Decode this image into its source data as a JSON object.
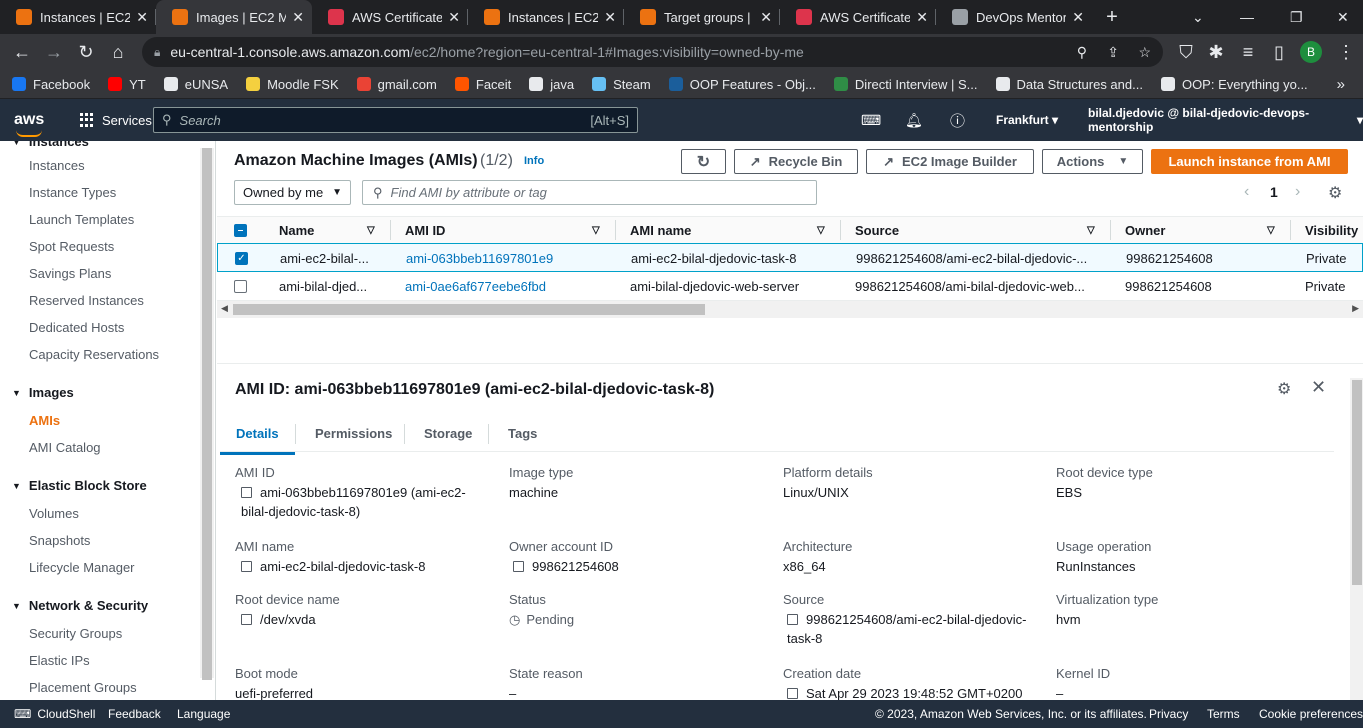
{
  "browser": {
    "tabs": [
      {
        "title": "Instances | EC2 M",
        "color": "#ec7211",
        "active": false
      },
      {
        "title": "Images | EC2 Man",
        "color": "#ec7211",
        "active": true
      },
      {
        "title": "AWS Certificate M",
        "color": "#dd344c",
        "active": false
      },
      {
        "title": "Instances | EC2 M",
        "color": "#ec7211",
        "active": false
      },
      {
        "title": "Target groups | E",
        "color": "#ec7211",
        "active": false
      },
      {
        "title": "AWS Certificate M",
        "color": "#dd344c",
        "active": false
      },
      {
        "title": "DevOps Mentorsh",
        "color": "#9aa0a6",
        "active": false
      }
    ],
    "url_host": "eu-central-1.console.aws.amazon.com",
    "url_path": "/ec2/home?region=eu-central-1#Images:visibility=owned-by-me",
    "profile_initial": "B",
    "bookmarks": [
      {
        "label": "Facebook",
        "color": "#1877f2"
      },
      {
        "label": "YT",
        "color": "#ff0000"
      },
      {
        "label": "eUNSA",
        "color": "#e8eaed"
      },
      {
        "label": "Moodle FSK",
        "color": "#f4d03f"
      },
      {
        "label": "gmail.com",
        "color": "#ea4335"
      },
      {
        "label": "Faceit",
        "color": "#ff5500"
      },
      {
        "label": "java",
        "color": "#e8eaed"
      },
      {
        "label": "Steam",
        "color": "#66c0f4"
      },
      {
        "label": "OOP Features - Obj...",
        "color": "#1b5e9b"
      },
      {
        "label": "Directi Interview | S...",
        "color": "#2f8d46"
      },
      {
        "label": "Data Structures and...",
        "color": "#e8eaed"
      },
      {
        "label": "OOP: Everything yo...",
        "color": "#e8eaed"
      }
    ]
  },
  "aws": {
    "logo": "aws",
    "services": "Services",
    "search_placeholder": "Search",
    "search_shortcut": "[Alt+S]",
    "region": "Frankfurt",
    "account": "bilal.djedovic @ bilal-djedovic-devops-mentorship"
  },
  "sidebar": {
    "items": [
      "Instances",
      "Instances",
      "Instance Types",
      "Launch Templates",
      "Spot Requests",
      "Savings Plans",
      "Reserved Instances",
      "Dedicated Hosts",
      "Capacity Reservations"
    ],
    "images_head": "Images",
    "images_items": [
      "AMIs",
      "AMI Catalog"
    ],
    "ebs_head": "Elastic Block Store",
    "ebs_items": [
      "Volumes",
      "Snapshots",
      "Lifecycle Manager"
    ],
    "net_head": "Network & Security",
    "net_items": [
      "Security Groups",
      "Elastic IPs",
      "Placement Groups"
    ]
  },
  "list": {
    "title": "Amazon Machine Images (AMIs)",
    "count": "(1/2)",
    "info": "Info",
    "recycle": "Recycle Bin",
    "builder": "EC2 Image Builder",
    "actions": "Actions",
    "launch": "Launch instance from AMI",
    "filter": "Owned by me",
    "find_placeholder": "Find AMI by attribute or tag",
    "page": "1",
    "headers": [
      "Name",
      "AMI ID",
      "AMI name",
      "Source",
      "Owner",
      "Visibility"
    ],
    "rows": [
      {
        "name": "ami-ec2-bilal-...",
        "id": "ami-063bbeb11697801e9",
        "ami_name": "ami-ec2-bilal-djedovic-task-8",
        "source": "998621254608/ami-ec2-bilal-djedovic-...",
        "owner": "998621254608",
        "visibility": "Private",
        "selected": true
      },
      {
        "name": "ami-bilal-djed...",
        "id": "ami-0ae6af677eebe6fbd",
        "ami_name": "ami-bilal-djedovic-web-server",
        "source": "998621254608/ami-bilal-djedovic-web...",
        "owner": "998621254608",
        "visibility": "Private",
        "selected": false
      }
    ]
  },
  "detail": {
    "title": "AMI ID: ami-063bbeb11697801e9 (ami-ec2-bilal-djedovic-task-8)",
    "tabs": [
      "Details",
      "Permissions",
      "Storage",
      "Tags"
    ],
    "fields": {
      "ami_id_l": "AMI ID",
      "ami_id_v1": "ami-063bbeb11697801e9 (ami-ec2-",
      "ami_id_v2": "bilal-djedovic-task-8)",
      "image_type_l": "Image type",
      "image_type_v": "machine",
      "platform_l": "Platform details",
      "platform_v": "Linux/UNIX",
      "root_type_l": "Root device type",
      "root_type_v": "EBS",
      "ami_name_l": "AMI name",
      "ami_name_v": "ami-ec2-bilal-djedovic-task-8",
      "owner_l": "Owner account ID",
      "owner_v": "998621254608",
      "arch_l": "Architecture",
      "arch_v": "x86_64",
      "usage_l": "Usage operation",
      "usage_v": "RunInstances",
      "root_name_l": "Root device name",
      "root_name_v": "/dev/xvda",
      "status_l": "Status",
      "status_v": "Pending",
      "source_l": "Source",
      "source_v1": "998621254608/ami-ec2-bilal-djedovic-",
      "source_v2": "task-8",
      "virt_l": "Virtualization type",
      "virt_v": "hvm",
      "boot_l": "Boot mode",
      "boot_v": "uefi-preferred",
      "reason_l": "State reason",
      "reason_v": "–",
      "created_l": "Creation date",
      "created_v": "Sat Apr 29 2023 19:48:52 GMT+0200",
      "kernel_l": "Kernel ID",
      "kernel_v": "–"
    }
  },
  "footer": {
    "cloudshell": "CloudShell",
    "feedback": "Feedback",
    "language": "Language",
    "copyright": "© 2023, Amazon Web Services, Inc. or its affiliates.",
    "privacy": "Privacy",
    "terms": "Terms",
    "cookies": "Cookie preferences"
  }
}
